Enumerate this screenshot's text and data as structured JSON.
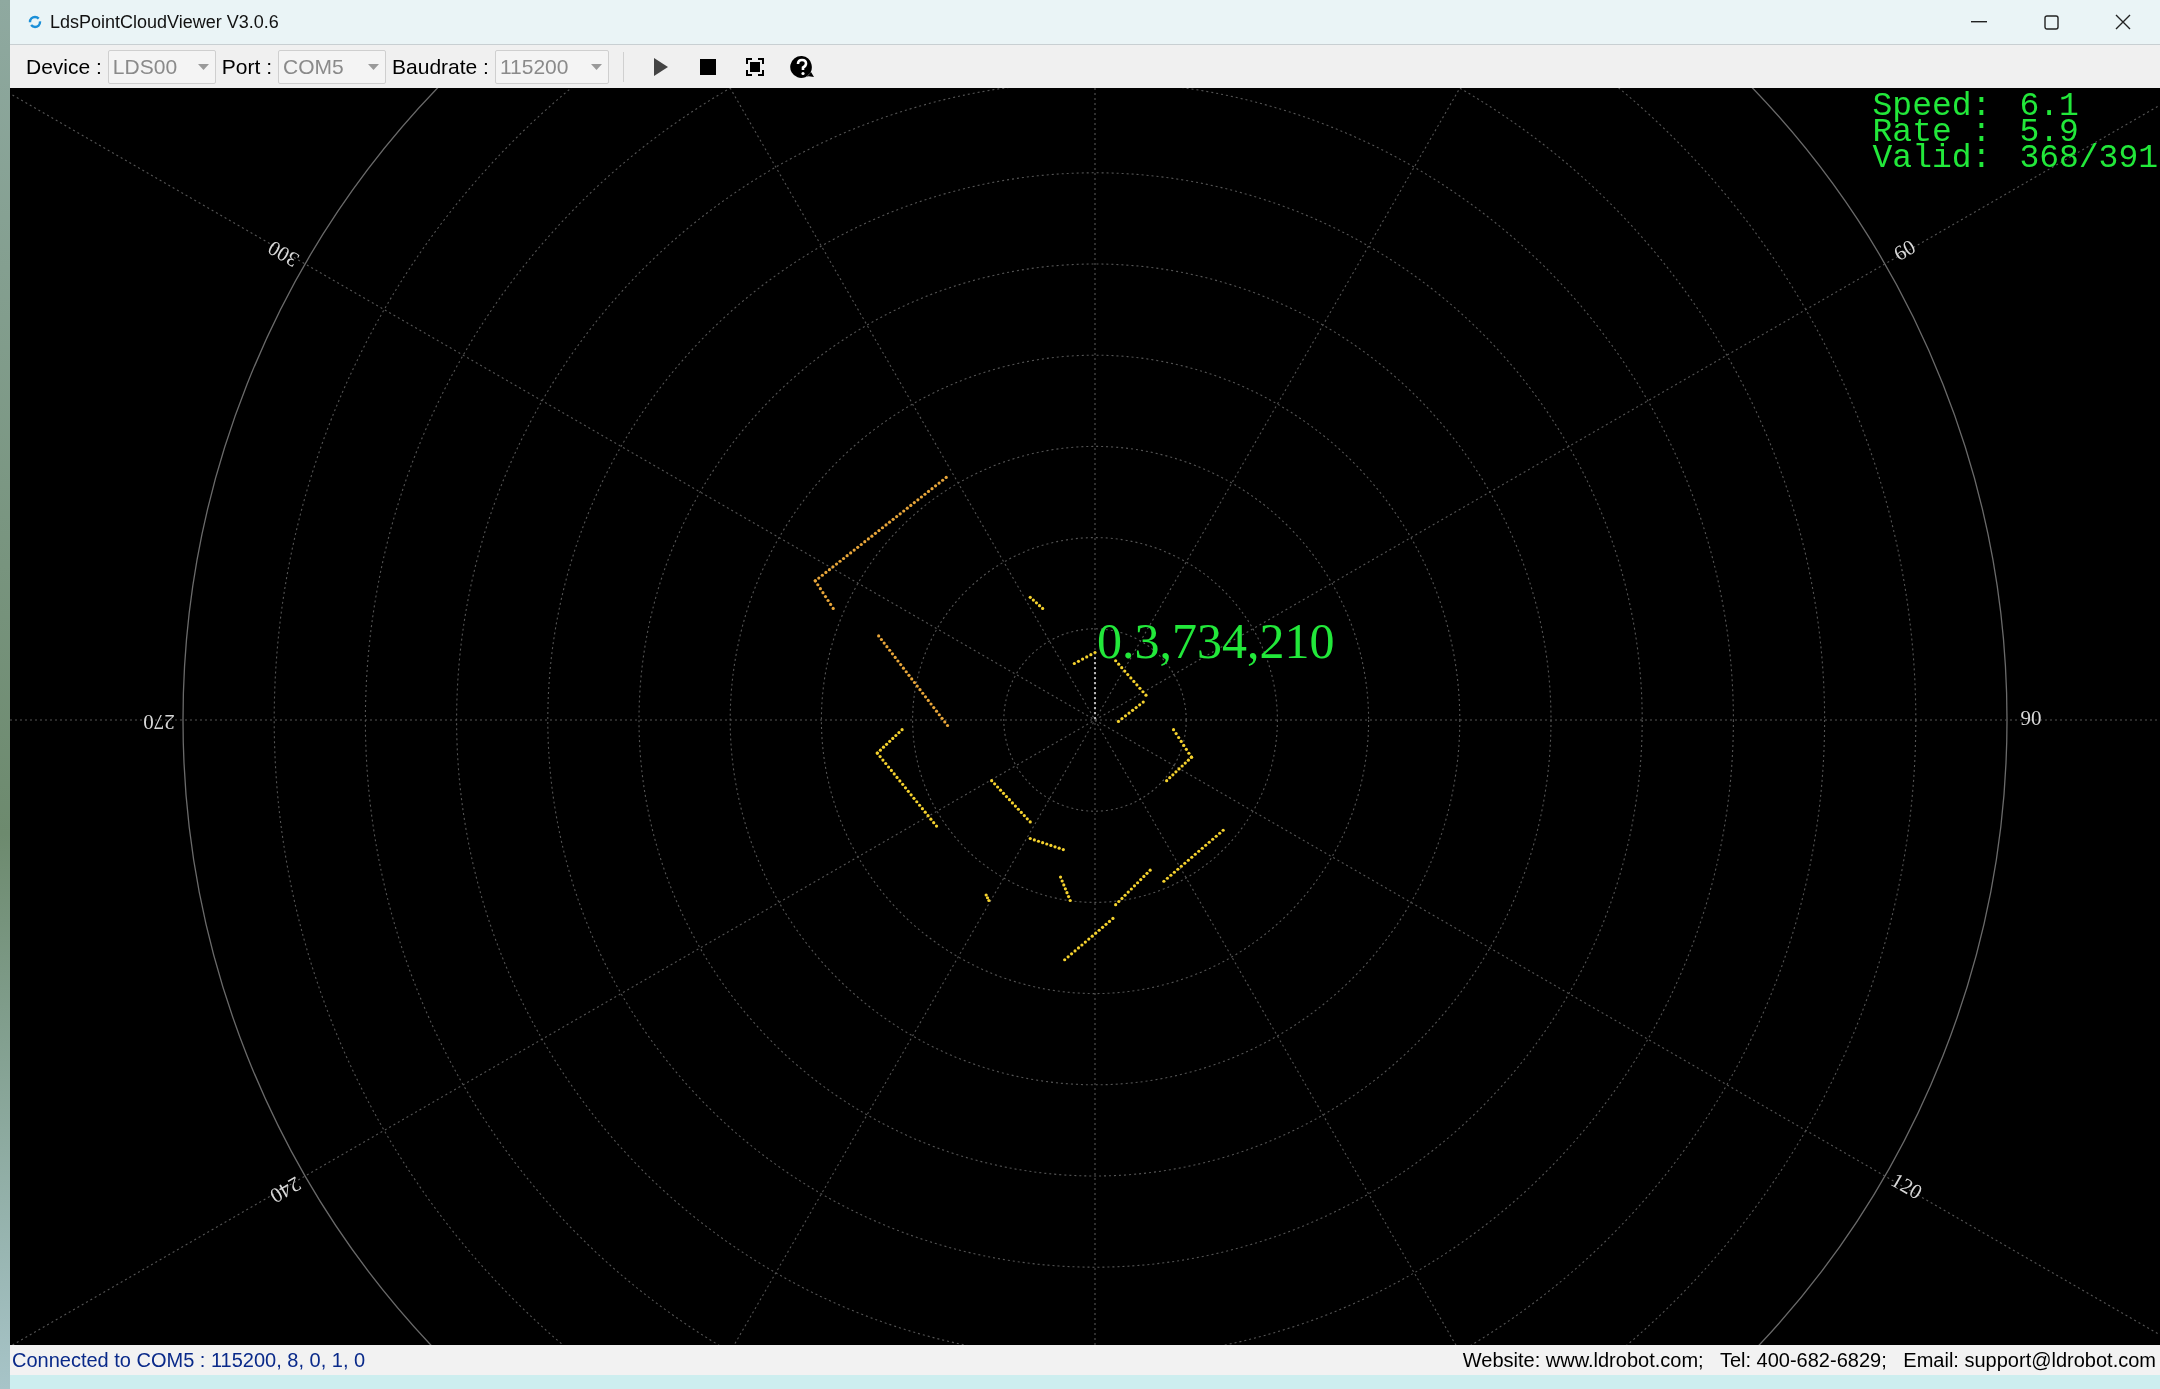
{
  "window": {
    "title": "LdsPointCloudViewer V3.0.6"
  },
  "toolbar": {
    "fields": [
      {
        "label": "Device :",
        "value": "LDS00",
        "disabled": true
      },
      {
        "label": "Port :",
        "value": "COM5",
        "disabled": true
      },
      {
        "label": "Baudrate :",
        "value": "115200",
        "disabled": true
      }
    ],
    "buttons": [
      {
        "kind": "play"
      },
      {
        "kind": "stop"
      },
      {
        "kind": "fit"
      },
      {
        "kind": "help"
      }
    ]
  },
  "plot": {
    "stats": [
      {
        "label": "Speed:",
        "value": "6.1"
      },
      {
        "label": "Rate :",
        "value": "5.9"
      },
      {
        "label": "Valid:",
        "value": "368/391"
      }
    ],
    "readout": "0.3,734,210",
    "angle_labels": [
      {
        "angle": "60"
      },
      {
        "angle": "90"
      },
      {
        "angle": "120"
      },
      {
        "angle": "240"
      },
      {
        "angle": "270"
      },
      {
        "angle": "300"
      }
    ]
  },
  "status_bar": {
    "connection": "Connected to COM5 : 115200, 8, 0, 1, 0",
    "contact": "Website: www.ldrobot.com;   Tel: 400-682-6829;   Email: support@ldrobot.com"
  }
}
